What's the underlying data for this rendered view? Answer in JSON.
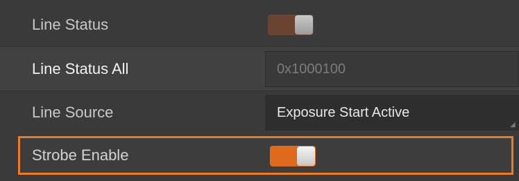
{
  "properties": {
    "line_status": {
      "label": "Line Status",
      "toggle_on": false
    },
    "line_status_all": {
      "label": "Line Status All",
      "value": "0x1000100"
    },
    "line_source": {
      "label": "Line Source",
      "value": "Exposure Start Active"
    },
    "strobe_enable": {
      "label": "Strobe Enable",
      "toggle_on": true
    }
  },
  "colors": {
    "highlight_border": "#f07a1c",
    "toggle_active": "#e06a1b",
    "toggle_inactive": "#6b4331"
  },
  "icons": {
    "resize_grip": "resize-grip-icon"
  }
}
